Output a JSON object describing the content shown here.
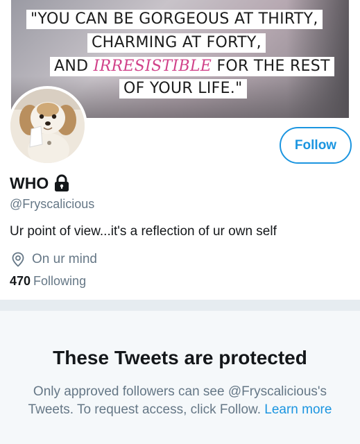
{
  "banner": {
    "quote_line1": "\"YOU CAN BE GORGEOUS AT THIRTY,",
    "quote_line2": "CHARMING AT FORTY,",
    "quote_line3_pre": "AND ",
    "quote_line3_highlight": "IRRESISTIBLE",
    "quote_line3_post": " FOR THE REST",
    "quote_line4": "OF YOUR LIFE.\""
  },
  "profile": {
    "name": "WHO",
    "handle": "@Fryscalicious",
    "bio": "Ur point of view...it's a reflection of ur own self",
    "location": "On ur mind",
    "following_count": "470",
    "following_label": "Following"
  },
  "actions": {
    "follow_label": "Follow"
  },
  "protected": {
    "title": "These Tweets are protected",
    "body": "Only approved followers can see @Fryscalicious's Tweets. To request access, click Follow.",
    "learn_more": "Learn more"
  },
  "icons": {
    "lock": "lock-icon",
    "location": "location-pin-icon"
  },
  "colors": {
    "accent": "#1b95e0",
    "secondary_text": "#657786",
    "highlight": "#d1428a"
  }
}
